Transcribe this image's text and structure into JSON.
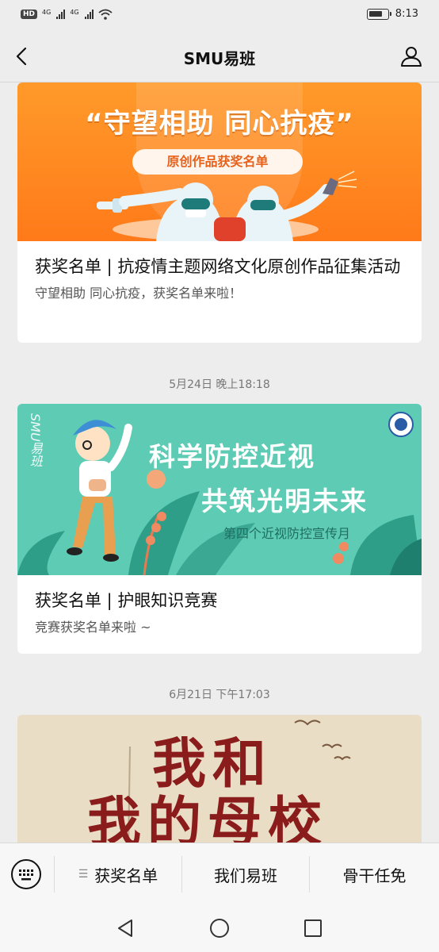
{
  "status_bar": {
    "hd_badge": "HD",
    "signal1_label": "4G",
    "signal2_label": "4G",
    "time": "8:13",
    "battery_level": 0.75
  },
  "nav": {
    "title": "SMU易班"
  },
  "articles": [
    {
      "banner_title": "“守望相助 同心抗疫”",
      "banner_pill": "原创作品获奖名单",
      "title": "获奖名单 | 抗疫情主题网络文化原创作品征集活动",
      "desc": "守望相助 同心抗疫，获奖名单来啦！"
    },
    {
      "date": "5月24日 晚上18:18",
      "banner_brand": "SMU易班",
      "banner_line1": "科学防控近视",
      "banner_line2": "共筑光明未来",
      "banner_sub": "第四个近视防控宣传月",
      "title": "获奖名单 | 护眼知识竞赛",
      "desc": "竞赛获奖名单来啦 ~"
    },
    {
      "date": "6月21日 下午17:03",
      "banner_line1": "我和",
      "banner_line2": "我的母校"
    }
  ],
  "bottom_menu": {
    "items": [
      "获奖名单",
      "我们易班",
      "骨干任免"
    ]
  },
  "colors": {
    "background": "#ededed",
    "banner1_orange": "#ff8a22",
    "banner2_teal": "#5ecbb4",
    "banner3_red": "#8a1c1c"
  }
}
